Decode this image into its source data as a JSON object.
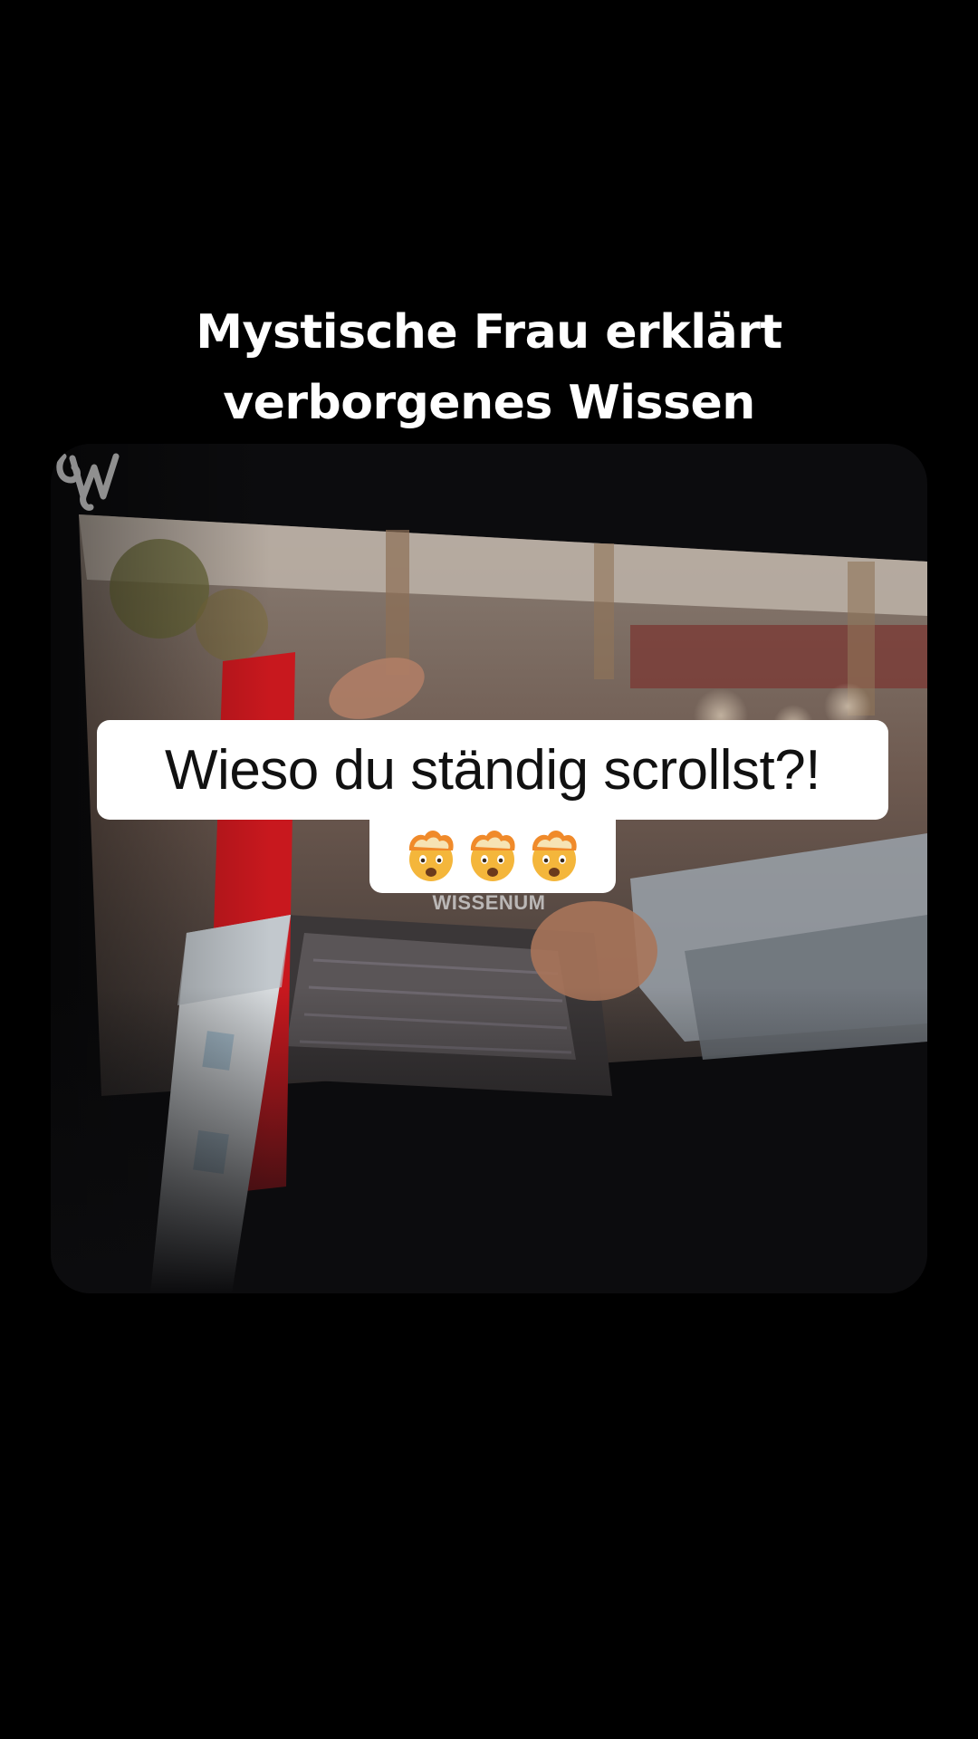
{
  "headline": {
    "line1": "Mystische Frau erklärt",
    "line2": "verborgenes Wissen"
  },
  "caption": {
    "text": "Wieso du ständig scrollst?!",
    "emojis": [
      "mind-blown-emoji",
      "mind-blown-emoji",
      "mind-blown-emoji"
    ]
  },
  "watermark": {
    "text": "WISSENUM",
    "logo_icon": "wissenum-logo-icon"
  },
  "colors": {
    "background": "#000000",
    "caption_bg": "#ffffff",
    "caption_text": "#111111",
    "headline_text": "#ffffff"
  }
}
